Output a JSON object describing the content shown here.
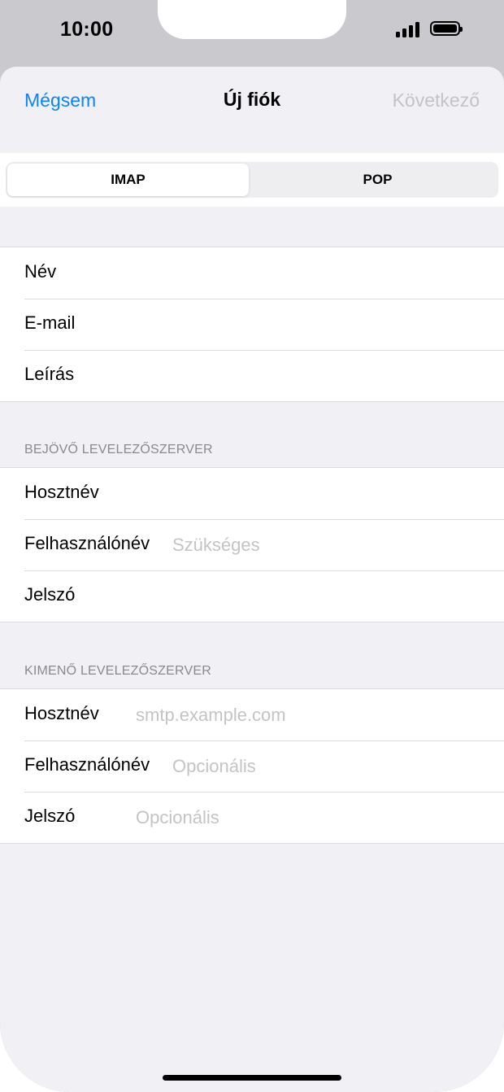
{
  "status_bar": {
    "time": "10:00"
  },
  "nav": {
    "cancel": "Mégsem",
    "title": "Új fiók",
    "next": "Következő"
  },
  "segments": {
    "imap": "IMAP",
    "pop": "POP"
  },
  "account": {
    "name_label": "Név",
    "email_label": "E-mail",
    "description_label": "Leírás"
  },
  "incoming": {
    "header": "BEJÖVŐ LEVELEZŐSZERVER",
    "host_label": "Hosztnév",
    "user_label": "Felhasználónév",
    "user_placeholder": "Szükséges",
    "password_label": "Jelszó"
  },
  "outgoing": {
    "header": "KIMENŐ LEVELEZŐSZERVER",
    "host_label": "Hosztnév",
    "host_placeholder": "smtp.example.com",
    "user_label": "Felhasználónév",
    "user_placeholder": "Opcionális",
    "password_label": "Jelszó",
    "password_placeholder": "Opcionális"
  },
  "colors": {
    "accent": "#0a84ff",
    "disabled": "#c4c4c7",
    "background": "#f0f0f5"
  },
  "icons": {
    "signal": "cellular-signal-icon",
    "battery": "battery-icon"
  }
}
